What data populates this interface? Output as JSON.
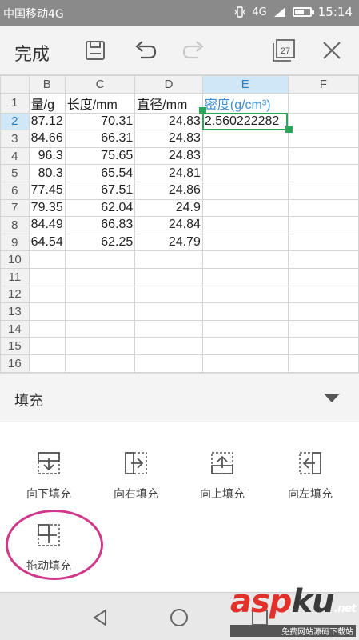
{
  "status_bar": {
    "carrier": "中国移动4G",
    "network": "4G",
    "time": "15:14",
    "battery_level": 0.55
  },
  "toolbar": {
    "done_label": "完成",
    "icons": [
      "save-icon",
      "undo-icon",
      "redo-icon",
      "sheets-icon",
      "close-icon"
    ],
    "sheets_count": "27"
  },
  "sheet": {
    "columns": [
      "B",
      "C",
      "D",
      "E",
      "F"
    ],
    "active_column": "E",
    "active_row": "2",
    "rows": [
      {
        "row": "1",
        "cells": [
          "量/g",
          "长度/mm",
          "直径/mm",
          "密度(g/cm³)",
          ""
        ]
      },
      {
        "row": "2",
        "cells": [
          "87.12",
          "70.31",
          "24.83",
          "2.560222282",
          ""
        ]
      },
      {
        "row": "3",
        "cells": [
          "84.66",
          "66.31",
          "24.83",
          "",
          ""
        ]
      },
      {
        "row": "4",
        "cells": [
          "96.3",
          "75.65",
          "24.83",
          "",
          ""
        ]
      },
      {
        "row": "5",
        "cells": [
          "80.3",
          "65.54",
          "24.81",
          "",
          ""
        ]
      },
      {
        "row": "6",
        "cells": [
          "77.45",
          "67.51",
          "24.86",
          "",
          ""
        ]
      },
      {
        "row": "7",
        "cells": [
          "79.35",
          "62.04",
          "24.9",
          "",
          ""
        ]
      },
      {
        "row": "8",
        "cells": [
          "84.49",
          "66.83",
          "24.84",
          "",
          ""
        ]
      },
      {
        "row": "9",
        "cells": [
          "64.54",
          "62.25",
          "24.79",
          "",
          ""
        ]
      },
      {
        "row": "10",
        "cells": [
          "",
          "",
          "",
          "",
          ""
        ]
      },
      {
        "row": "11",
        "cells": [
          "",
          "",
          "",
          "",
          ""
        ]
      },
      {
        "row": "12",
        "cells": [
          "",
          "",
          "",
          "",
          ""
        ]
      },
      {
        "row": "13",
        "cells": [
          "",
          "",
          "",
          "",
          ""
        ]
      },
      {
        "row": "14",
        "cells": [
          "",
          "",
          "",
          "",
          ""
        ]
      },
      {
        "row": "15",
        "cells": [
          "",
          "",
          "",
          "",
          ""
        ]
      },
      {
        "row": "16",
        "cells": [
          "",
          "",
          "",
          "",
          ""
        ]
      }
    ]
  },
  "fill_panel": {
    "title": "填充",
    "options": [
      {
        "label": "向下填充",
        "icon": "fill-down-icon"
      },
      {
        "label": "向右填充",
        "icon": "fill-right-icon"
      },
      {
        "label": "向上填充",
        "icon": "fill-up-icon"
      },
      {
        "label": "向左填充",
        "icon": "fill-left-icon"
      },
      {
        "label": "拖动填充",
        "icon": "drag-fill-icon"
      }
    ]
  },
  "nav_bar": {
    "icons": [
      "back-icon",
      "home-icon",
      "recents-icon"
    ]
  },
  "watermark": {
    "logo_main": "asp",
    "logo_accent": "ku",
    "logo_suffix": ".net",
    "subtitle": "免费网站源码下载站"
  },
  "colors": {
    "accent_green": "#2aa55a",
    "header_blue": "#3a8fd6",
    "annotation_circle": "#d0398a"
  }
}
